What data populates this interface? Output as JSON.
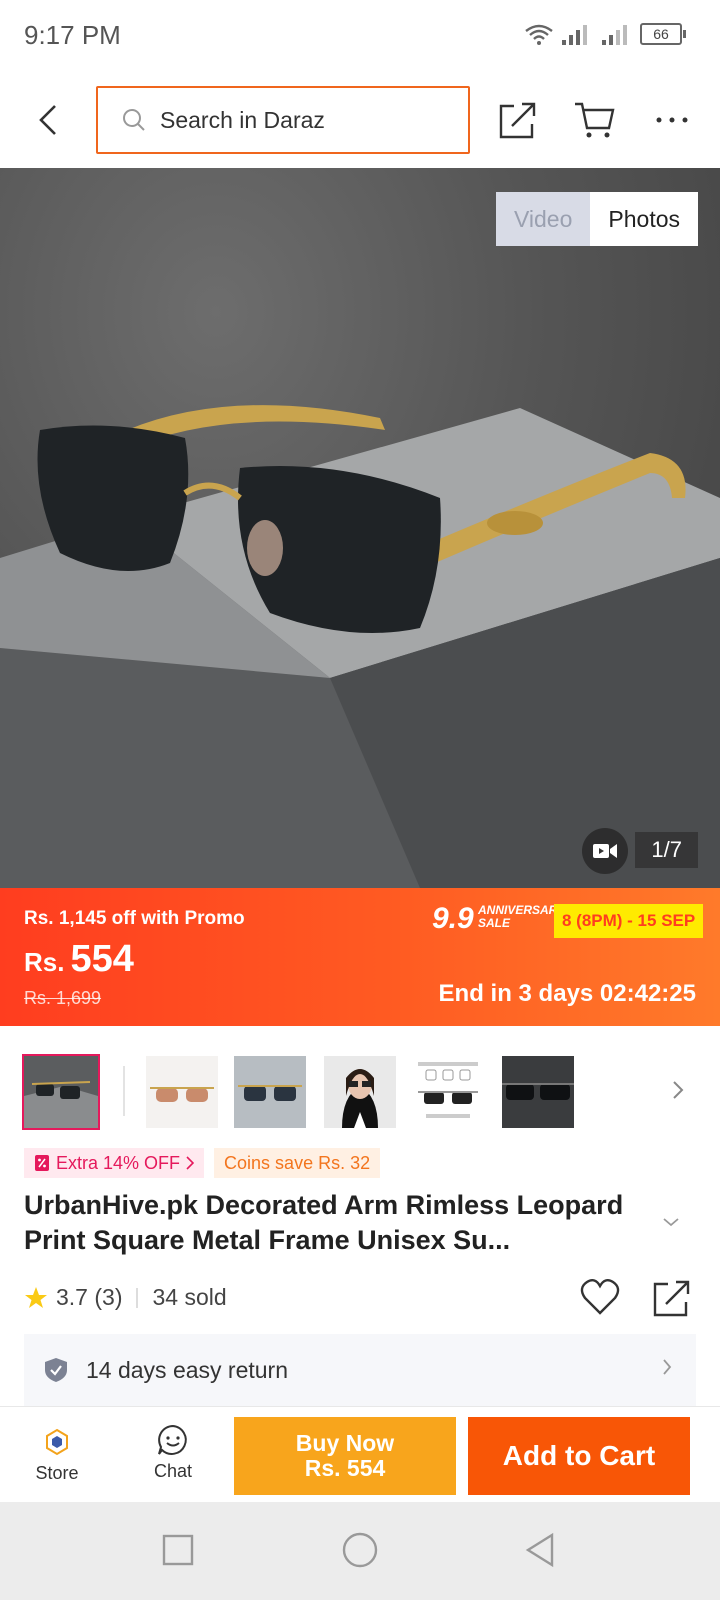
{
  "status": {
    "time": "9:17 PM",
    "battery": "66"
  },
  "header": {
    "search_placeholder": "Search in Daraz",
    "icons": [
      "back-icon",
      "search-icon",
      "share-icon",
      "cart-icon",
      "more-icon"
    ]
  },
  "gallery": {
    "toggle": [
      "Video",
      "Photos"
    ],
    "selected_toggle": "Photos",
    "page_counter": "1/7"
  },
  "promo": {
    "discount_text": "Rs. 1,145 off with Promo",
    "currency": "Rs.",
    "price": "554",
    "original_price": "Rs. 1,699",
    "sale_number": "9.9",
    "sale_tag": "ANNIVERSARY SALE",
    "sale_dates": "8 (8PM) - 15 SEP",
    "countdown": "End in 3 days 02:42:25"
  },
  "thumbnails": {
    "count": 7,
    "selected_index": 0
  },
  "tags": {
    "extra": "Extra 14% OFF",
    "coins": "Coins save Rs. 32"
  },
  "product": {
    "title": "UrbanHive.pk Decorated Arm Rimless Leopard Print Square Metal Frame Unisex Su...",
    "rating": "3.7 (3)",
    "sold": "34 sold",
    "return_policy": "14 days easy return"
  },
  "actions": {
    "store_label": "Store",
    "chat_label": "Chat",
    "buy_now_label": "Buy Now",
    "buy_now_price": "Rs. 554",
    "add_to_cart_label": "Add to Cart"
  },
  "colors": {
    "accent": "#f85606",
    "buy_now": "#f8a51c",
    "promo_start": "#ff3d1f",
    "promo_end": "#ff7a2a",
    "pink_tag": "#e5195c",
    "coins_tag": "#f3751e",
    "sale_dates_bg": "#ffea00"
  }
}
